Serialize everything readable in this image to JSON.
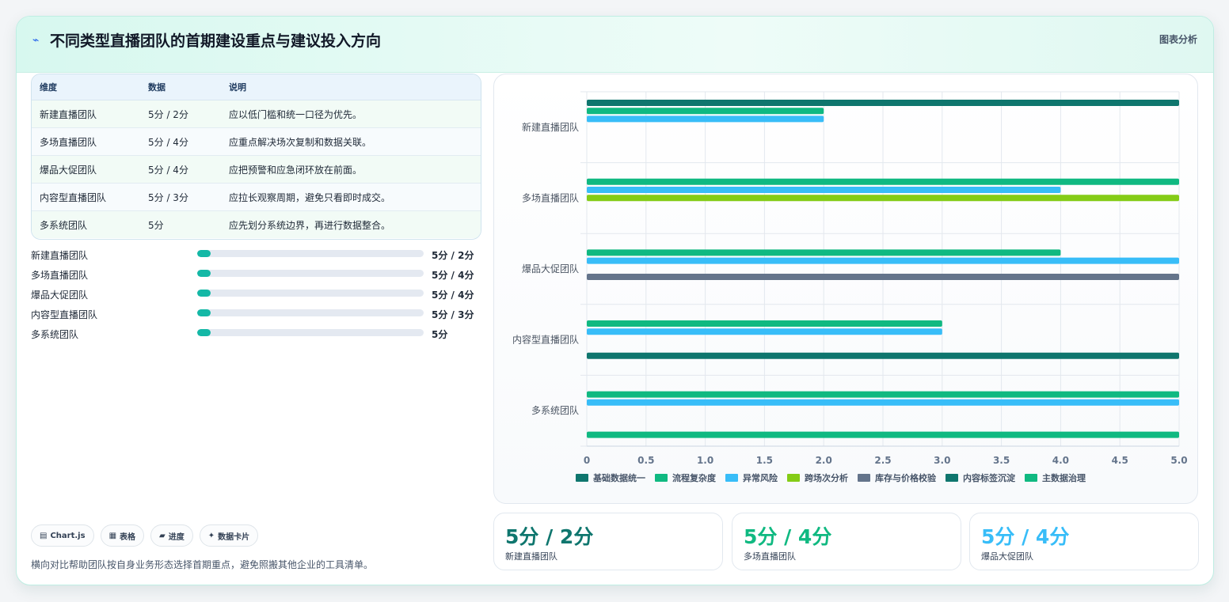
{
  "header": {
    "icon": "⌁",
    "title": "不同类型直播团队的首期建设重点与建议投入方向",
    "tag": "图表分析"
  },
  "table": {
    "headers": [
      "维度",
      "数据",
      "说明"
    ],
    "rows": [
      [
        "新建直播团队",
        "5分 / 2分",
        "应以低门槛和统一口径为优先。"
      ],
      [
        "多场直播团队",
        "5分 / 4分",
        "应重点解决场次复制和数据关联。"
      ],
      [
        "爆品大促团队",
        "5分 / 4分",
        "应把预警和应急闭环放在前面。"
      ],
      [
        "内容型直播团队",
        "5分 / 3分",
        "应拉长观察周期，避免只看即时成交。"
      ],
      [
        "多系统团队",
        "5分",
        "应先划分系统边界，再进行数据整合。"
      ]
    ]
  },
  "progress": [
    {
      "label": "新建直播团队",
      "value": "5分 / 2分",
      "fill": 0.06
    },
    {
      "label": "多场直播团队",
      "value": "5分 / 4分",
      "fill": 0.06
    },
    {
      "label": "爆品大促团队",
      "value": "5分 / 4分",
      "fill": 0.06
    },
    {
      "label": "内容型直播团队",
      "value": "5分 / 3分",
      "fill": 0.06
    },
    {
      "label": "多系统团队",
      "value": "5分",
      "fill": 0.06
    }
  ],
  "chips": [
    {
      "icon": "▤",
      "label": "Chart.js"
    },
    {
      "icon": "▦",
      "label": "表格"
    },
    {
      "icon": "▰",
      "label": "进度"
    },
    {
      "icon": "✦",
      "label": "数据卡片"
    }
  ],
  "description": "横向对比帮助团队按自身业务形态选择首期重点，避免照搬其他企业的工具清单。",
  "stats": [
    {
      "value": "5分 / 2分",
      "label": "新建直播团队",
      "color": "#0f766e"
    },
    {
      "value": "5分 / 4分",
      "label": "多场直播团队",
      "color": "#10b981"
    },
    {
      "value": "5分 / 4分",
      "label": "爆品大促团队",
      "color": "#38bdf8"
    }
  ],
  "chart_data": {
    "type": "bar",
    "orientation": "horizontal",
    "categories": [
      "新建直播团队",
      "多场直播团队",
      "爆品大促团队",
      "内容型直播团队",
      "多系统团队"
    ],
    "xlim": [
      0,
      5
    ],
    "xticks": [
      "0",
      "0.5",
      "1.0",
      "1.5",
      "2.0",
      "2.5",
      "3.0",
      "3.5",
      "4.0",
      "4.5",
      "5.0"
    ],
    "grid": true,
    "legend_position": "bottom",
    "series": [
      {
        "name": "基础数据统一",
        "color": "#0f766e",
        "values": [
          5,
          null,
          null,
          null,
          null
        ]
      },
      {
        "name": "流程复杂度",
        "color": "#10b981",
        "values": [
          2,
          null,
          null,
          null,
          null
        ]
      },
      {
        "name": "异常风险",
        "color": "#38bdf8",
        "values": [
          2,
          null,
          null,
          null,
          null
        ]
      },
      {
        "name": "跨场次分析",
        "color": "#84cc16",
        "values": [
          null,
          null,
          null,
          null,
          null
        ]
      },
      {
        "name": "库存与价格校验",
        "color": "#64748b",
        "values": [
          null,
          null,
          null,
          null,
          null
        ]
      },
      {
        "name": "内容标签沉淀",
        "color": "#0f766e",
        "values": [
          null,
          null,
          null,
          null,
          null
        ]
      },
      {
        "name": "主数据治理",
        "color": "#10b981",
        "values": [
          null,
          null,
          null,
          null,
          null
        ]
      }
    ],
    "bars": [
      {
        "category": "新建直播团队",
        "series": "基础数据统一",
        "value": 5,
        "slot": 0
      },
      {
        "category": "新建直播团队",
        "series": "流程复杂度",
        "value": 2,
        "slot": 1
      },
      {
        "category": "新建直播团队",
        "series": "异常风险",
        "value": 2,
        "slot": 2
      },
      {
        "category": "多场直播团队",
        "series": "流程复杂度",
        "value": 5,
        "slot": 1
      },
      {
        "category": "多场直播团队",
        "series": "异常风险",
        "value": 4,
        "slot": 2
      },
      {
        "category": "多场直播团队",
        "series": "跨场次分析",
        "value": 5,
        "slot": 3
      },
      {
        "category": "爆品大促团队",
        "series": "流程复杂度",
        "value": 4,
        "slot": 1
      },
      {
        "category": "爆品大促团队",
        "series": "异常风险",
        "value": 5,
        "slot": 2
      },
      {
        "category": "爆品大促团队",
        "series": "库存与价格校验",
        "value": 5,
        "slot": 4
      },
      {
        "category": "内容型直播团队",
        "series": "流程复杂度",
        "value": 3,
        "slot": 1
      },
      {
        "category": "内容型直播团队",
        "series": "异常风险",
        "value": 3,
        "slot": 2
      },
      {
        "category": "内容型直播团队",
        "series": "内容标签沉淀",
        "value": 5,
        "slot": 5
      },
      {
        "category": "多系统团队",
        "series": "流程复杂度",
        "value": 5,
        "slot": 1
      },
      {
        "category": "多系统团队",
        "series": "异常风险",
        "value": 5,
        "slot": 2
      },
      {
        "category": "多系统团队",
        "series": "主数据治理",
        "value": 5,
        "slot": 6
      }
    ]
  }
}
